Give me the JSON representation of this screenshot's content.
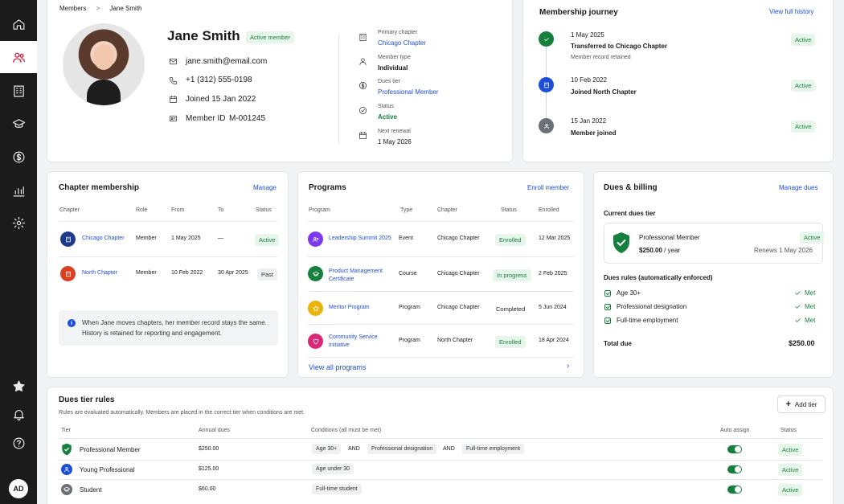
{
  "breadcrumb": {
    "root": "Members",
    "sep": ">",
    "current": "Jane Smith"
  },
  "profile": {
    "name": "Jane Smith",
    "status_badge": "Active member",
    "email": "jane.smith@email.com",
    "phone": "+1 (312) 555-0198",
    "joined": "Joined 15 Jan 2022",
    "member_id_label": "Member ID",
    "member_id": "M-001245",
    "fields": [
      {
        "label": "Primary chapter",
        "value": "Chicago Chapter",
        "icon": "building-icon"
      },
      {
        "label": "Member type",
        "value": "Individual",
        "icon": "user-icon"
      },
      {
        "label": "Dues tier",
        "value": "Professional Member",
        "icon": "dollar-icon"
      },
      {
        "label": "Status",
        "value": "Active",
        "icon": "check-circle-icon"
      },
      {
        "label": "Next renewal",
        "value": "1 May 2026",
        "icon": "calendar-icon"
      }
    ]
  },
  "journey": {
    "title": "Membership journey",
    "link": "View full history",
    "events": [
      {
        "date": "1 May 2025",
        "title": "Transferred to Chicago Chapter",
        "note": "Member record retained",
        "status": "Active"
      },
      {
        "date": "10 Feb 2022",
        "title": "Joined North Chapter",
        "note": "",
        "status": "Active"
      },
      {
        "date": "15 Jan 2022",
        "title": "Member joined",
        "note": "",
        "status": "Active"
      }
    ]
  },
  "chapter_membership": {
    "title": "Chapter membership",
    "action": "Manage",
    "columns": [
      "Chapter",
      "Role",
      "From",
      "To",
      "Status"
    ],
    "rows": [
      {
        "chapter": "Chicago Chapter",
        "role": "Member",
        "from": "1 May 2025",
        "to": "—",
        "status": "Active"
      },
      {
        "chapter": "North Chapter",
        "role": "Member",
        "from": "10 Feb 2022",
        "to": "30 Apr 2025",
        "status": "Past"
      }
    ],
    "info": "When Jane moves chapters, her member record stays the same. History is retained for reporting and engagement."
  },
  "programs": {
    "title": "Programs",
    "action": "Enroll member",
    "columns": [
      "Program",
      "Type",
      "Chapter",
      "Status",
      "Enrolled"
    ],
    "rows": [
      {
        "program": "Leadership Summit 2025",
        "type": "Event",
        "chapter": "Chicago Chapter",
        "status": "Enrolled",
        "enrolled": "12 Mar 2025"
      },
      {
        "program": "Product Management Certificate",
        "type": "Course",
        "chapter": "Chicago Chapter",
        "status": "In progress",
        "enrolled": "2 Feb 2025"
      },
      {
        "program": "Mentor Program",
        "type": "Program",
        "chapter": "Chicago Chapter",
        "status": "Completed",
        "enrolled": "5 Jun 2024"
      },
      {
        "program": "Community Service Initiative",
        "type": "Program",
        "chapter": "North Chapter",
        "status": "Enrolled",
        "enrolled": "18 Apr 2024"
      }
    ],
    "view_all": "View all programs"
  },
  "dues": {
    "title": "Dues & billing",
    "action": "Manage dues",
    "current_label": "Current dues tier",
    "tier": "Professional Member",
    "tier_status": "Active",
    "price": "$250.00",
    "period": "/ year",
    "renews": "Renews 1 May 2026",
    "rules_label": "Dues rules (automatically enforced)",
    "rules": [
      {
        "name": "Age 30+",
        "result": "Met"
      },
      {
        "name": "Professional designation",
        "result": "Met"
      },
      {
        "name": "Full-time employment",
        "result": "Met"
      }
    ],
    "total_label": "Total due",
    "total": "$250.00"
  },
  "tier_rules": {
    "title": "Dues tier rules",
    "subtitle": "Rules are evaluated automatically. Members are placed in the correct tier when conditions are met.",
    "add": "Add tier",
    "columns": [
      "Tier",
      "Annual dues",
      "Conditions (all must be met)",
      "Auto assign",
      "Status"
    ],
    "and": "AND",
    "rows": [
      {
        "tier": "Professional Member",
        "dues": "$250.00",
        "conditions": [
          "Age 30+",
          "Professional designation",
          "Full-time employment"
        ],
        "status": "Active"
      },
      {
        "tier": "Young Professional",
        "dues": "$125.00",
        "conditions": [
          "Age under 30"
        ],
        "status": "Active"
      },
      {
        "tier": "Student",
        "dues": "$60.00",
        "conditions": [
          "Full-time student"
        ],
        "status": "Active"
      }
    ]
  },
  "user_initials": "AD",
  "colors": {
    "accent": "#c8102e",
    "link": "#1d4ed8",
    "success": "#15803d"
  }
}
